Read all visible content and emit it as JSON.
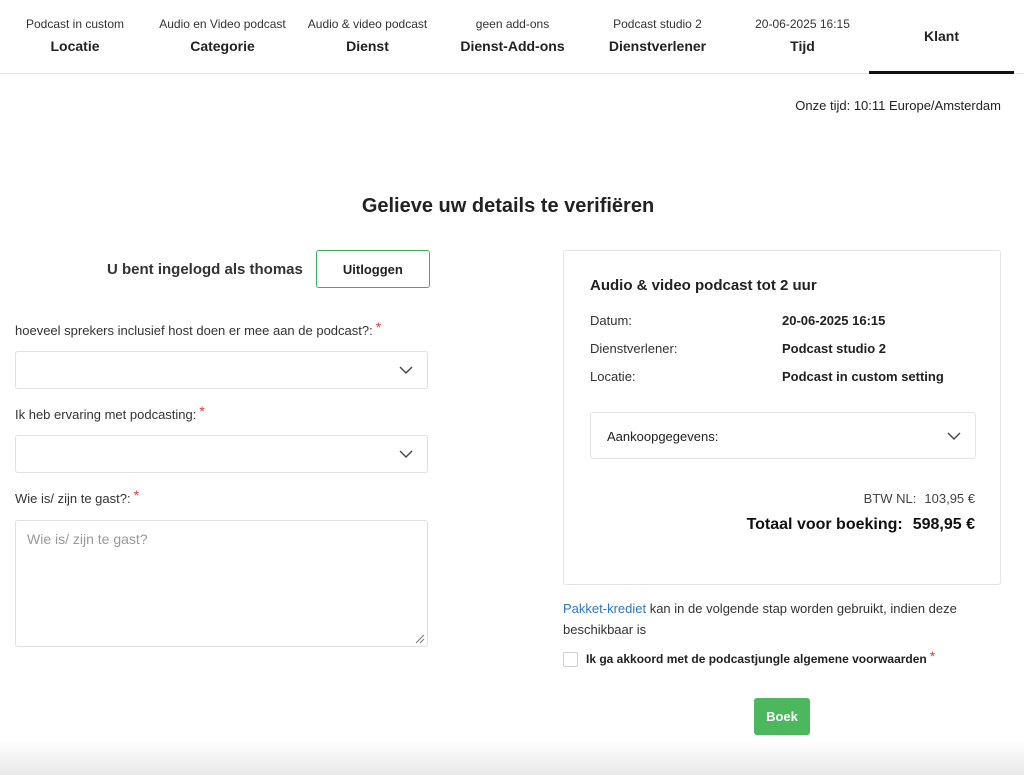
{
  "steps": [
    {
      "sub": "Podcast in custom",
      "title": "Locatie"
    },
    {
      "sub": "Audio en Video podcast",
      "title": "Categorie"
    },
    {
      "sub": "Audio & video podcast",
      "title": "Dienst"
    },
    {
      "sub": "geen add-ons",
      "title": "Dienst-Add-ons"
    },
    {
      "sub": "Podcast studio 2",
      "title": "Dienstverlener"
    },
    {
      "sub": "20-06-2025 16:15",
      "title": "Tijd"
    },
    {
      "sub": "",
      "title": "Klant"
    }
  ],
  "timezone": "Onze tijd: 10:11 Europe/Amsterdam",
  "heading": "Gelieve uw details te verifiëren",
  "user": {
    "logged_in_text": "U bent ingelogd als thomas",
    "logout_label": "Uitloggen"
  },
  "form": {
    "speakers_label": "hoeveel sprekers inclusief host doen er mee aan de podcast?:",
    "experience_label": "Ik heb ervaring met podcasting:",
    "guest_label": "Wie is/ zijn te gast?:",
    "guest_placeholder": "Wie is/ zijn te gast?",
    "required_mark": "*"
  },
  "summary": {
    "title": "Audio & video podcast tot 2 uur",
    "rows": [
      {
        "key": "Datum:",
        "value": "20-06-2025 16:15"
      },
      {
        "key": "Dienstverlener:",
        "value": "Podcast studio 2"
      },
      {
        "key": "Locatie:",
        "value": "Podcast in custom setting"
      }
    ],
    "purchase_label": "Aankoopgegevens:",
    "vat_label": "BTW NL:",
    "vat_value": "103,95 €",
    "total_label": "Totaal voor boeking:",
    "total_value": "598,95 €"
  },
  "credit": {
    "link": "Pakket-krediet",
    "text": " kan in de volgende stap worden gebruikt, indien deze beschikbaar is"
  },
  "agree_text": "Ik ga akkoord met de podcastjungle algemene voorwaarden",
  "book_label": "Boek",
  "colors": {
    "accent": "#4cb85e",
    "link": "#2c76c9",
    "required": "#e53935"
  }
}
